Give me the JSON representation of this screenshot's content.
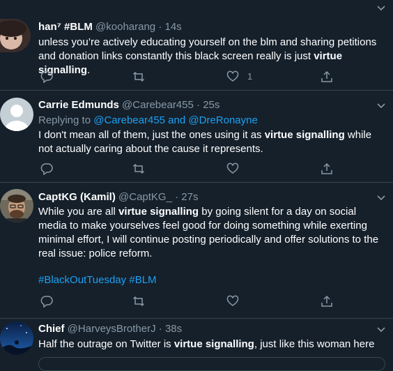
{
  "colors": {
    "background": "#15202b",
    "text": "#ffffff",
    "muted": "#8899a6",
    "link": "#1da1f2",
    "divider": "#38444d"
  },
  "tweets": [
    {
      "name": "han⁷ #BLM",
      "handle": "@kooharang",
      "time": "14s",
      "text_pre": "unless you’re actively educating yourself on the blm and sharing petitions and donation links constantly this black screen really is just ",
      "text_bold": "virtue signalling",
      "text_post": ".",
      "like_count": "1"
    },
    {
      "name": "Carrie Edmunds",
      "handle": "@Carebear455",
      "time": "25s",
      "replying_label": "Replying to ",
      "replying_user1": "@Carebear455",
      "replying_and": " and ",
      "replying_user2": "@DreRonayne",
      "text_pre": "I don't mean all of them, just the ones using it as ",
      "text_bold": "virtue signalling",
      "text_post": " while not actually caring about the cause it represents."
    },
    {
      "name": "CaptKG (Kamil)",
      "handle": "@CaptKG_",
      "time": "27s",
      "text_pre": "While you are all ",
      "text_bold": "virtue signalling",
      "text_post": " by going silent for a day on social media to make yourselves feel good for doing something while exerting minimal effort, I will continue posting periodically and offer solutions to the real issue: police reform.",
      "hashtag1": "#BlackOutTuesday",
      "hashtag2": "#BLM"
    },
    {
      "name": "Chief",
      "handle": "@HarveysBrotherJ",
      "time": "38s",
      "text_pre": "Half the outrage on Twitter is ",
      "text_bold": "virtue signalling",
      "text_post": ", just like this woman here"
    }
  ],
  "separator": "·"
}
